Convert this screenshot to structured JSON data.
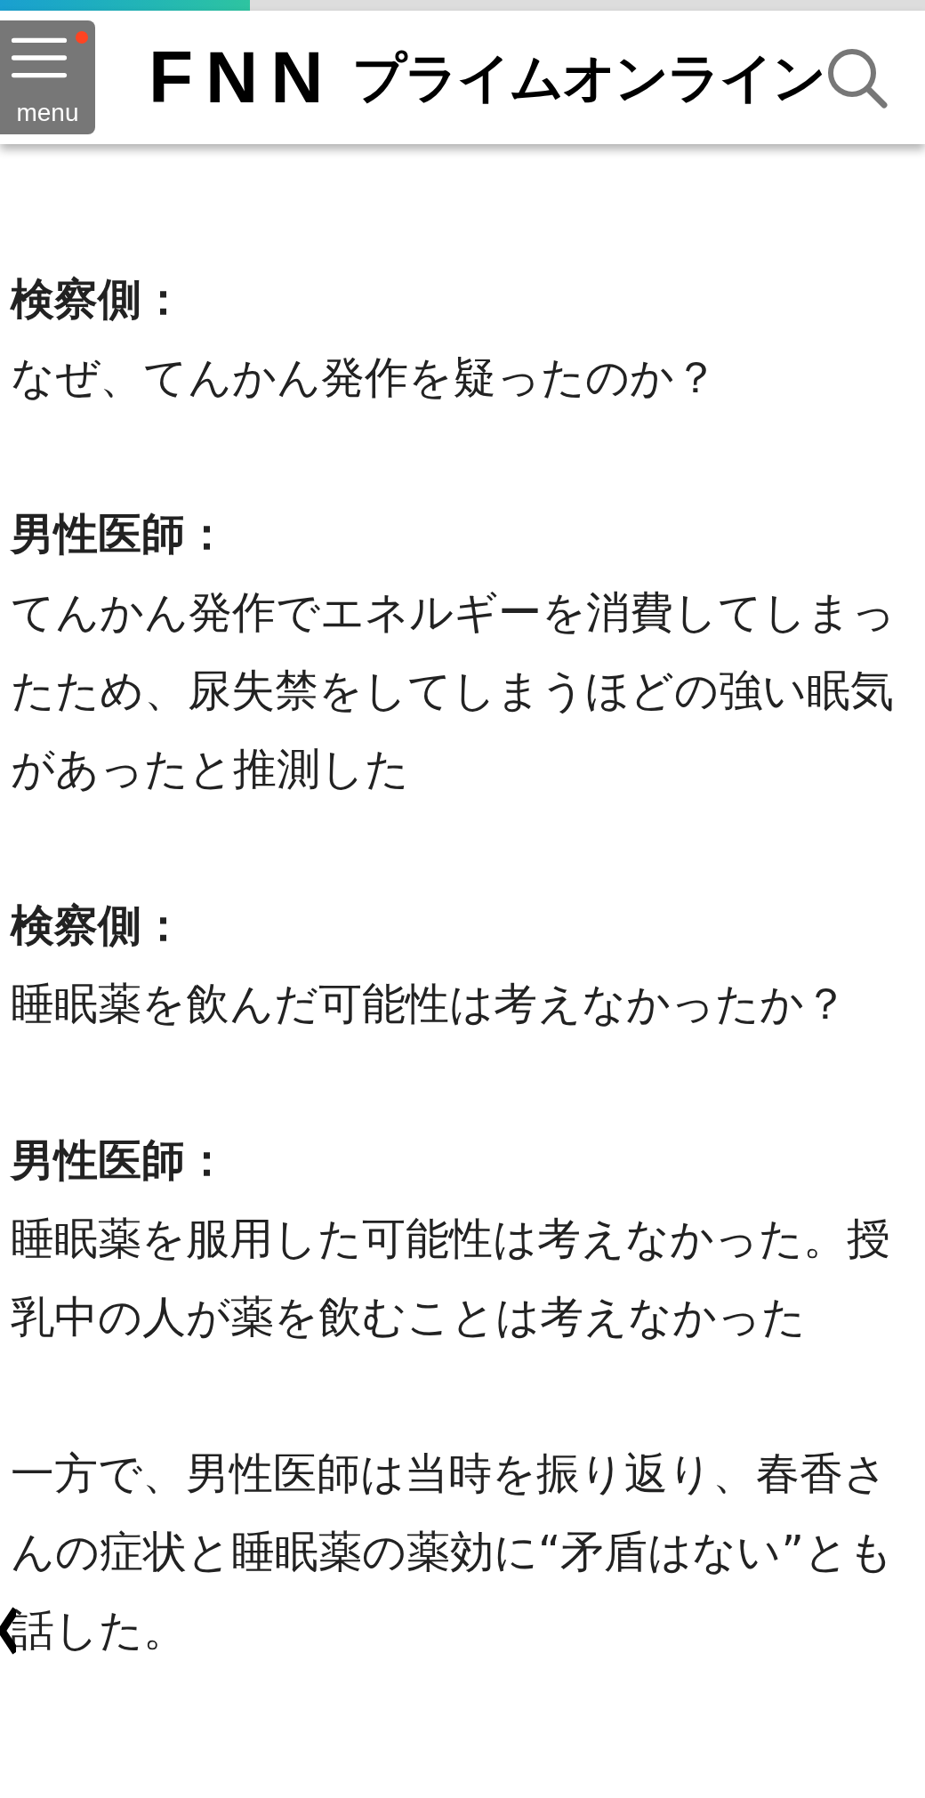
{
  "progress": {
    "level": 0.27
  },
  "header": {
    "menu_label": "menu",
    "menu_badge": true,
    "logo_letters": "FNN",
    "logo_text": "プライムオンライン"
  },
  "article": [
    {
      "kind": "speaker",
      "text": "検察側："
    },
    {
      "kind": "text",
      "text": "なぜ、てんかん発作を疑ったのか？"
    },
    {
      "kind": "speaker",
      "text": "男性医師："
    },
    {
      "kind": "text",
      "text": "てんかん発作でエネルギーを消費してしまったため、尿失禁をしてしまうほどの強い眠気があったと推測した"
    },
    {
      "kind": "speaker",
      "text": "検察側："
    },
    {
      "kind": "text",
      "text": "睡眠薬を飲んだ可能性は考えなかったか？"
    },
    {
      "kind": "speaker",
      "text": "男性医師："
    },
    {
      "kind": "text",
      "text": "睡眠薬を服用した可能性は考えなかった。授乳中の人が薬を飲むことは考えなかった"
    },
    {
      "kind": "text",
      "text": "一方で、男性医師は当時を振り返り、春香さんの症状と睡眠薬の薬効に“矛盾はない”とも話した。"
    }
  ]
}
